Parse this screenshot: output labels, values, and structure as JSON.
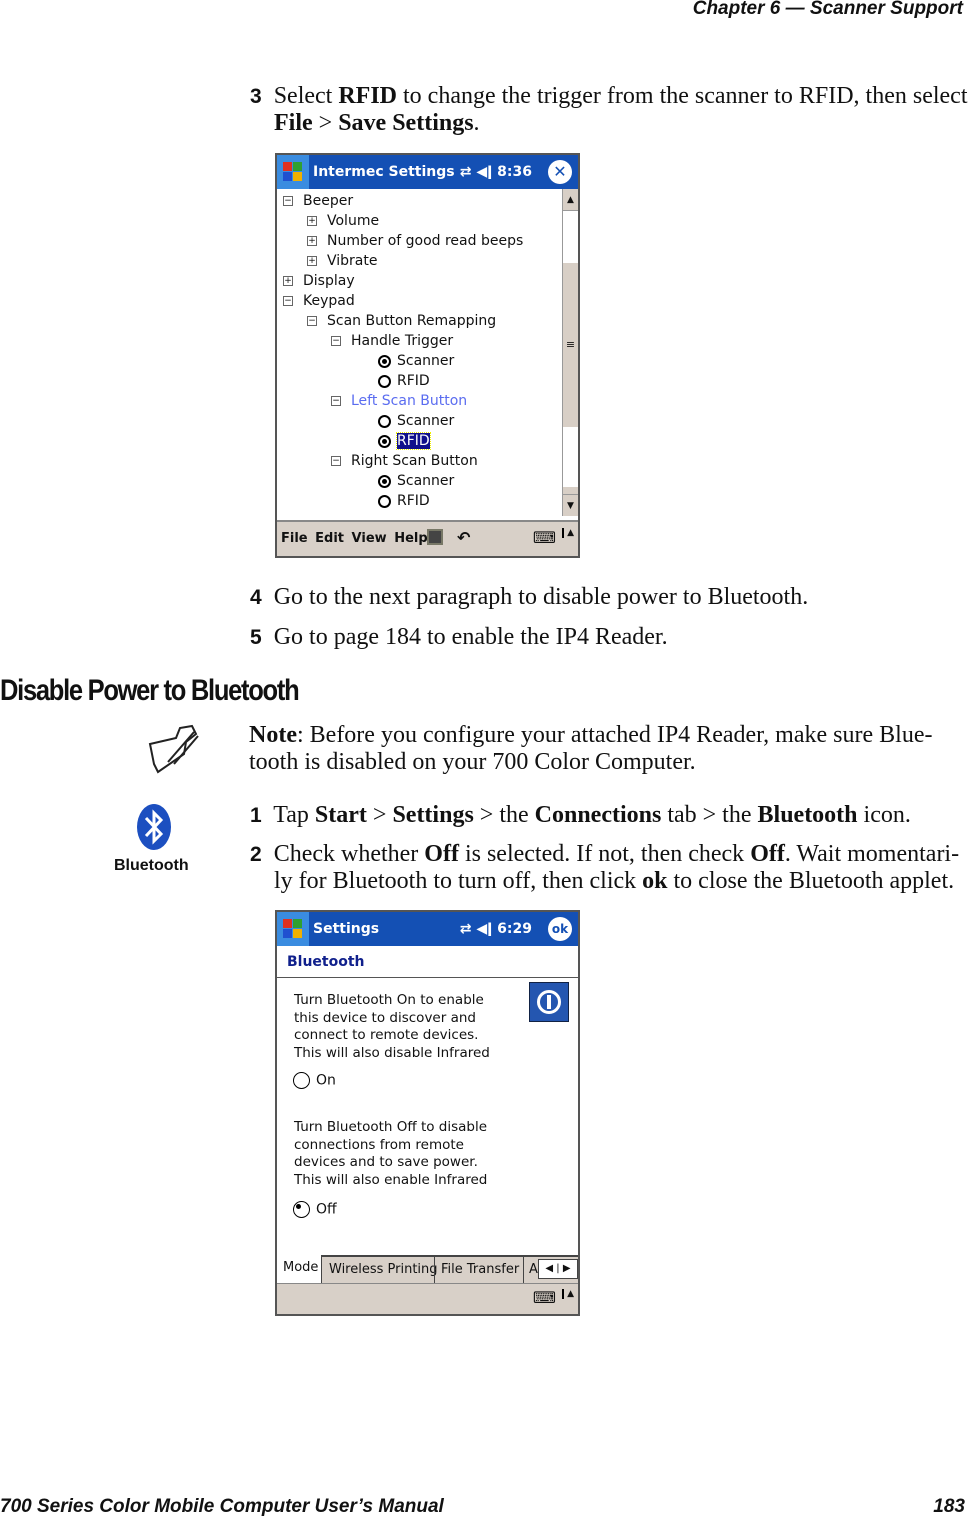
{
  "header": {
    "chapter": "Chapter  6  —  Scanner Support"
  },
  "footer": {
    "manual": "700 Series Color Mobile Computer User’s Manual",
    "page": "183"
  },
  "step3": {
    "num": "3",
    "t1": "Select ",
    "b1": "RFID",
    "t2": " to change the trigger from the scanner to RFID, then select",
    "b2": "File",
    "t3": " > ",
    "b3": "Save Settings",
    "t4": "."
  },
  "screen1": {
    "title": "Intermec Settings",
    "time": "8:36",
    "close": "✕",
    "tree": [
      "Beeper",
      "Volume",
      "Number of good read beeps",
      "Vibrate",
      "Display",
      "Keypad",
      "Scan Button Remapping",
      "Handle Trigger",
      "Scanner",
      "RFID",
      "Left Scan Button",
      "Scanner",
      "RFID",
      "Right Scan Button",
      "Scanner",
      "RFID"
    ],
    "menu": [
      "File",
      "Edit",
      "View",
      "Help"
    ]
  },
  "step4": {
    "num": "4",
    "text": "Go to the next paragraph to disable power to Bluetooth."
  },
  "step5": {
    "num": "5",
    "text": "Go to page 184 to enable the IP4 Reader."
  },
  "section": {
    "title": "Disable Power to Bluetooth"
  },
  "note": {
    "label": "Note",
    "line1": ": Before you configure your attached IP4 Reader, make sure Blue-",
    "line2": "tooth is disabled on your 700 Color Computer."
  },
  "bt_icon": {
    "label": "Bluetooth"
  },
  "bstep1": {
    "num": "1",
    "t1": "Tap ",
    "b1": "Start",
    "t2": " > ",
    "b2": "Settings",
    "t3": " > the ",
    "b3": "Connections",
    "t4": " tab > the ",
    "b4": "Bluetooth",
    "t5": " icon."
  },
  "bstep2": {
    "num": "2",
    "t1": "Check whether ",
    "b1": "Off",
    "t2": " is selected. If not, then check ",
    "b2": "Off",
    "t3": ". Wait momentari-",
    "t4": "ly for Bluetooth to turn off, then click ",
    "b3": "ok",
    "t5": " to close the Bluetooth applet."
  },
  "screen2": {
    "title": "Settings",
    "time": "6:29",
    "ok": "ok",
    "heading": "Bluetooth",
    "on_text": [
      "Turn Bluetooth On to enable",
      "this device to discover and",
      "connect to remote devices.",
      "This will also disable Infrared"
    ],
    "on_label": "On",
    "off_text": [
      "Turn Bluetooth Off to disable",
      "connections from remote",
      "devices and to save power.",
      "This will also enable Infrared"
    ],
    "off_label": "Off",
    "tabs": [
      "Mode",
      "Wireless Printing",
      "File Transfer",
      "A"
    ]
  }
}
